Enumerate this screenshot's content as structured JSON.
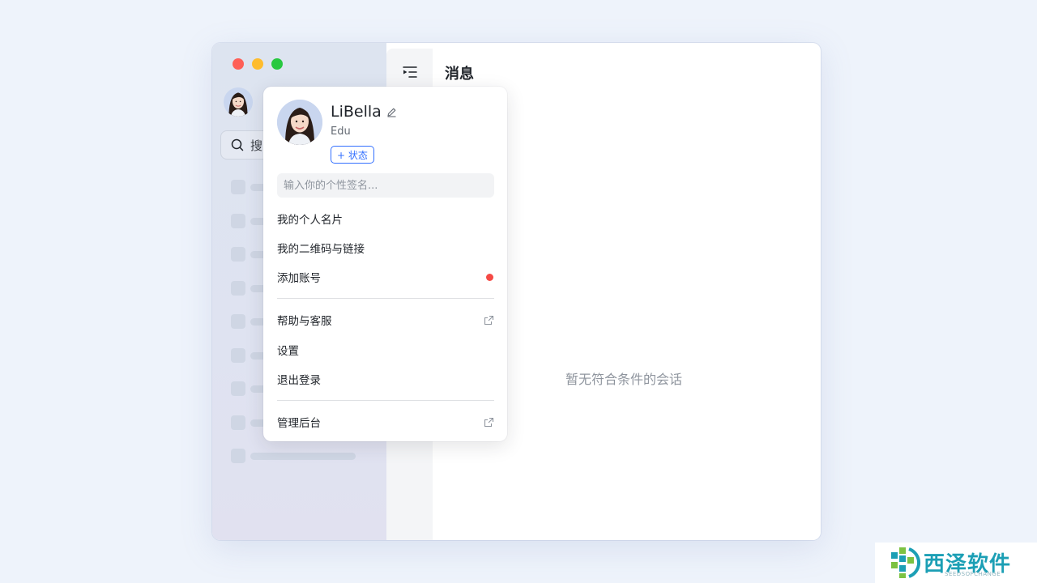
{
  "window": {
    "traffic_lights": [
      "close",
      "minimize",
      "maximize"
    ]
  },
  "sidebar": {
    "search_label": "搜",
    "skeleton_rows": 9
  },
  "main": {
    "title": "消息",
    "empty_text": "暂无符合条件的会话"
  },
  "profile_menu": {
    "name": "LiBella",
    "org": "Edu",
    "status_button": "+ 状态",
    "signature_placeholder": "输入你的个性签名...",
    "items": [
      {
        "label": "我的个人名片"
      },
      {
        "label": "我的二维码与链接"
      },
      {
        "label": "添加账号",
        "badge": "red-dot"
      },
      {
        "label": "帮助与客服",
        "icon": "external-link-icon"
      },
      {
        "label": "设置"
      },
      {
        "label": "退出登录"
      },
      {
        "label": "管理后台",
        "icon": "external-link-icon"
      }
    ]
  },
  "watermark": {
    "text": "西泽软件",
    "sub": "SEEDSOFCHANGE"
  },
  "colors": {
    "accent": "#3370ff",
    "badge_red": "#f54a45",
    "watermark": "#1c9fb5"
  }
}
